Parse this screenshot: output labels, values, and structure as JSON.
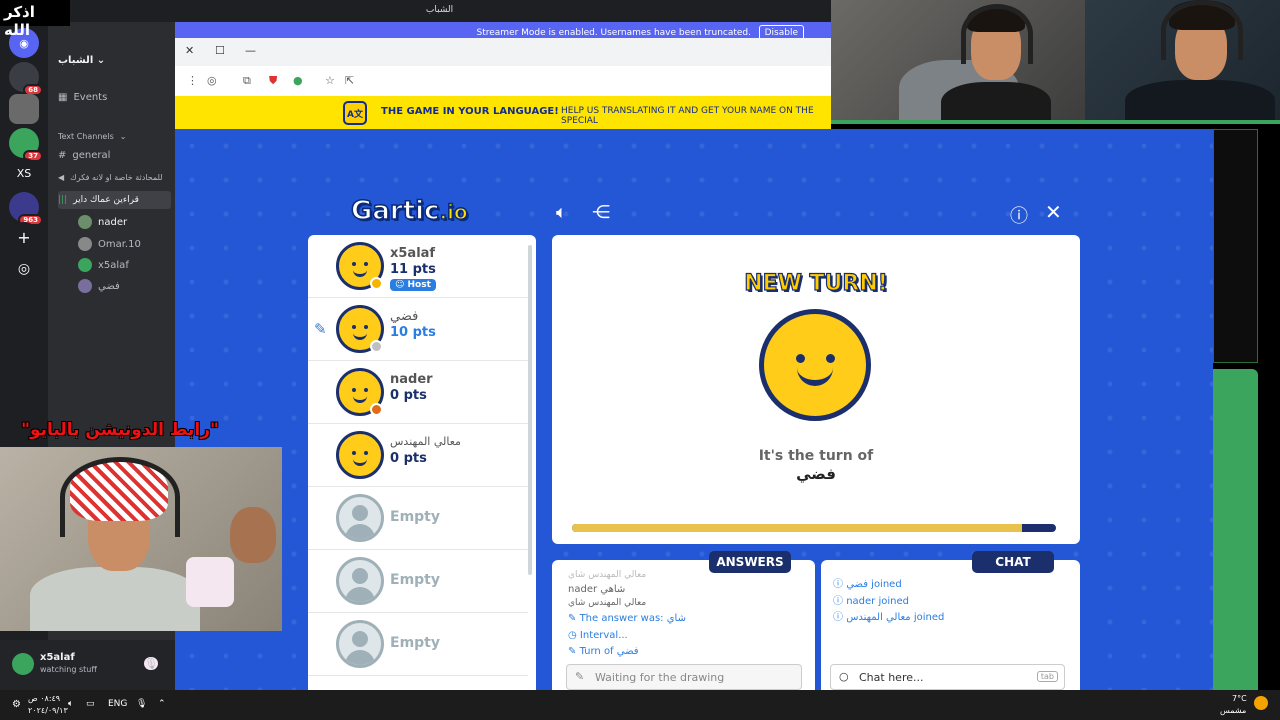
{
  "overlay": {
    "top_left_text": "اذكر الله",
    "donation_text": "\"رابط الدونيشن بالبايو\""
  },
  "discord": {
    "window_title": "الشباب",
    "streamer_notice": "Streamer Mode is enabled. Usernames have been truncated.",
    "streamer_disable": "Disable",
    "rail": [
      {
        "label": "",
        "badge": ""
      },
      {
        "label": "",
        "badge": "68"
      },
      {
        "label": "",
        "badge": ""
      },
      {
        "label": "",
        "badge": "37"
      },
      {
        "label": "XS",
        "badge": ""
      },
      {
        "label": "",
        "badge": "963"
      },
      {
        "label": "+",
        "badge": ""
      },
      {
        "label": "◎",
        "badge": ""
      }
    ],
    "guild_name": "الشباب",
    "events": "Events",
    "text_channels_header": "Text Channels",
    "channels": [
      "general",
      "للمحادثة خاصة او لانه فكرك"
    ],
    "voice_channel": "قراءين عماك داير",
    "voice_users": [
      "nader",
      "Omar.10",
      "x5alaf",
      "فضي"
    ],
    "user": {
      "name": "x5alaf",
      "status": "watching stuff"
    }
  },
  "browser": {
    "controls": [
      "✕",
      "☐",
      "—"
    ]
  },
  "banner": {
    "headline": "THE GAME IN YOUR LANGUAGE!",
    "sub": "HELP US TRANSLATING IT AND GET YOUR NAME ON THE SPECIAL"
  },
  "game": {
    "logo_main": "Gartic",
    "logo_suffix": ".io",
    "players": [
      {
        "name": "x5alaf",
        "points": "11 pts",
        "badge": "Host",
        "status_color": "#f5b400"
      },
      {
        "name": "فضي",
        "points": "10 pts",
        "badge": "",
        "status_color": "#c0c0c0",
        "drawing": true
      },
      {
        "name": "nader",
        "points": "0 pts",
        "badge": "",
        "status_color": "#e06a1a"
      },
      {
        "name": "معالي المهندس",
        "points": "0 pts",
        "badge": "",
        "status_color": ""
      }
    ],
    "empty_slots": [
      "Empty",
      "Empty",
      "Empty"
    ],
    "new_turn": "NEW TURN!",
    "turn_of_label": "It's the turn of",
    "turn_player": "فضي",
    "turn_progress": 0.93,
    "answers_tab": "ANSWERS",
    "chat_tab": "CHAT",
    "answers": [
      {
        "text": "معالي المهندس شاي",
        "type": "faded"
      },
      {
        "text": "nader شاهي",
        "type": "normal"
      },
      {
        "text": "معالي المهندس شاي",
        "type": "normal"
      },
      {
        "text": "The answer was: شاي",
        "type": "system",
        "icon": "pencil-icon"
      },
      {
        "text": "Interval...",
        "type": "system",
        "icon": "clock-icon"
      },
      {
        "text": "Turn of فضي",
        "type": "system",
        "icon": "pencil-icon"
      }
    ],
    "answer_placeholder": "Waiting for the drawing",
    "chat": [
      {
        "text": "فضي joined"
      },
      {
        "text": "nader joined"
      },
      {
        "text": "معالي المهندس joined"
      }
    ],
    "chat_placeholder": "Chat here...",
    "chat_key_hint": "tab"
  },
  "taskbar": {
    "time": "٠٨:٤٩ ص",
    "date": "٢٠٢٤/٠٩/١٣",
    "lang": "ENG",
    "weather_temp": "7°C",
    "weather_desc": "مشمس"
  },
  "colors": {
    "game_bg": "#2457d6",
    "accent_blue": "#2a7de1",
    "navy": "#1a2f6b",
    "yellow": "#ffcc00"
  }
}
